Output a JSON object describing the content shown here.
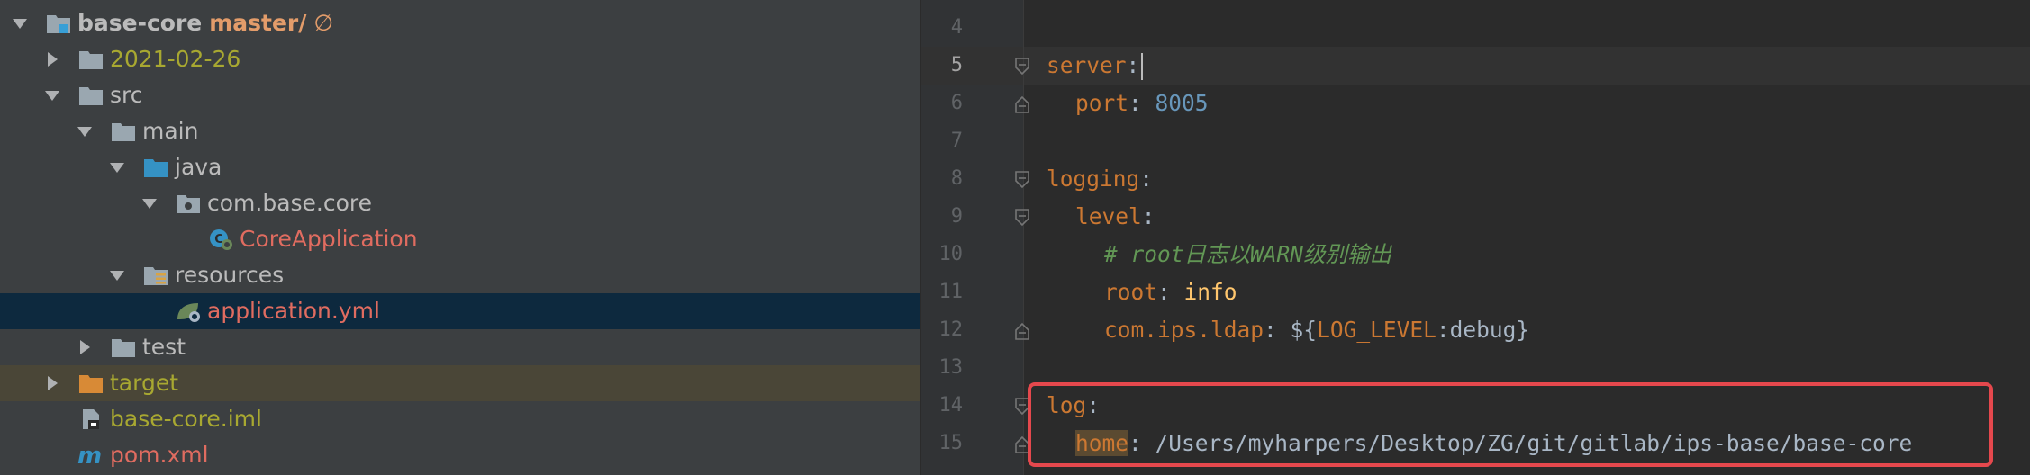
{
  "project_tree": {
    "root": {
      "name": "base-core",
      "branch": "master",
      "branch_sep": "/",
      "status": "∅"
    },
    "items": [
      {
        "label": "2021-02-26"
      },
      {
        "label": "src"
      },
      {
        "label": "main"
      },
      {
        "label": "java"
      },
      {
        "label": "com.base.core"
      },
      {
        "label": "CoreApplication"
      },
      {
        "label": "resources"
      },
      {
        "label": "application.yml"
      },
      {
        "label": "test"
      },
      {
        "label": "target"
      },
      {
        "label": "base-core.iml"
      },
      {
        "label": "pom.xml"
      }
    ]
  },
  "editor": {
    "line_numbers": [
      "4",
      "5",
      "6",
      "7",
      "8",
      "9",
      "10",
      "11",
      "12",
      "13",
      "14",
      "15"
    ],
    "current_line": "5",
    "lines": {
      "l5_key": "server",
      "l5_colon": ":",
      "l6_key": "port",
      "l6_colon": ":",
      "l6_value": "8005",
      "l8_key": "logging",
      "l8_colon": ":",
      "l9_key": "level",
      "l9_colon": ":",
      "l10_comment": "# root日志以WARN级别输出",
      "l11_key": "root",
      "l11_colon": ":",
      "l11_value": "info",
      "l12_key": "com.ips.ldap",
      "l12_colon": ":",
      "l12_open": "${",
      "l12_env": "LOG_LEVEL",
      "l12_rest": ":debug}",
      "l14_key": "log",
      "l14_colon": ":",
      "l15_key": "home",
      "l15_colon": ":",
      "l15_value": "/Users/myharpers/Desktop/ZG/git/gitlab/ips-base/base-core"
    }
  },
  "colors": {
    "tree_bg": "#3c3f41",
    "selected_row": "#0d293e",
    "editor_bg": "#2b2b2b",
    "key": "#cc7832",
    "number": "#6897bb",
    "comment": "#629755",
    "highlight_box": "#e5484d"
  },
  "icons": [
    "tree-arrow-expanded-icon",
    "tree-arrow-collapsed-icon",
    "module-icon",
    "folder-icon",
    "source-folder-icon",
    "package-icon",
    "spring-boot-class-icon",
    "resources-folder-icon",
    "spring-yaml-icon",
    "excluded-folder-icon",
    "iml-file-icon",
    "maven-icon",
    "fold-marker-icon"
  ]
}
